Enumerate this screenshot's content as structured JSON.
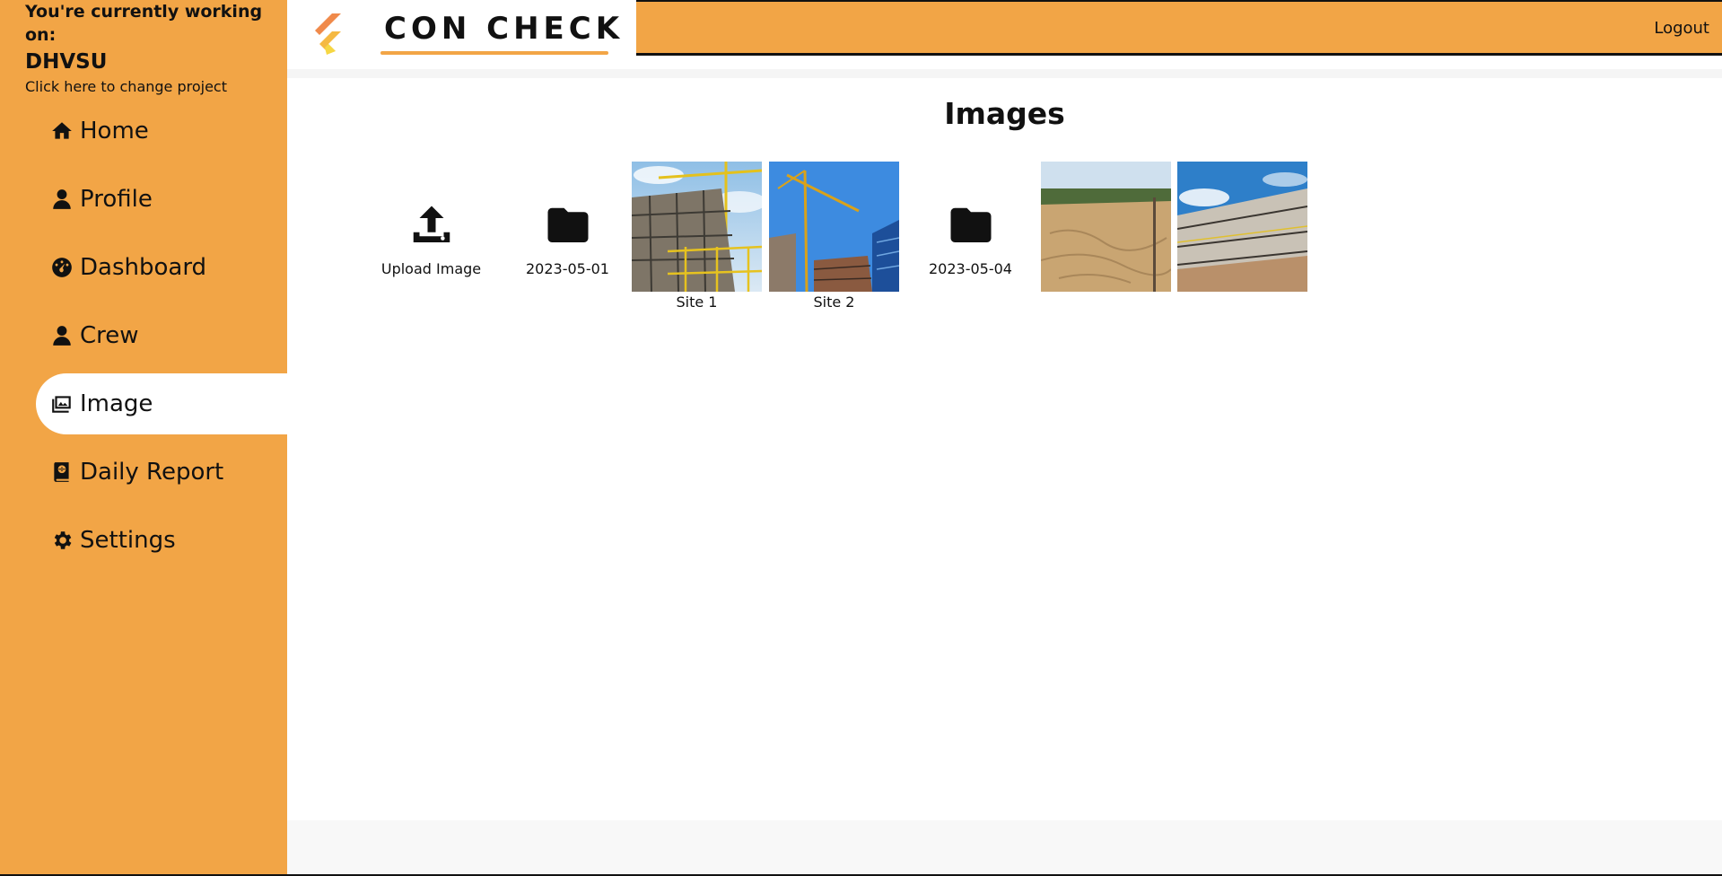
{
  "project": {
    "caption": "You're currently working on:",
    "name": "DHVSU",
    "change_link": "Click here to change project"
  },
  "brand": {
    "logo_text": "CON CHECK",
    "accent_color": "#F2A546"
  },
  "header": {
    "logout_label": "Logout"
  },
  "nav": [
    {
      "label": "Home",
      "icon": "home-icon"
    },
    {
      "label": "Profile",
      "icon": "person-icon"
    },
    {
      "label": "Dashboard",
      "icon": "dashboard-icon"
    },
    {
      "label": "Crew",
      "icon": "person-icon"
    },
    {
      "label": "Image",
      "icon": "photo-library-icon",
      "active": true
    },
    {
      "label": "Daily Report",
      "icon": "report-book-icon"
    },
    {
      "label": "Settings",
      "icon": "gear-icon"
    }
  ],
  "main": {
    "title": "Images",
    "tiles": [
      {
        "kind": "upload",
        "label": "Upload Image",
        "icon": "upload-icon"
      },
      {
        "kind": "folder",
        "label": "2023-05-01",
        "icon": "folder-icon"
      },
      {
        "kind": "photo",
        "label": "Site 1"
      },
      {
        "kind": "photo",
        "label": "Site 2"
      },
      {
        "kind": "folder",
        "label": "2023-05-04",
        "icon": "folder-icon"
      },
      {
        "kind": "photo",
        "label": ""
      },
      {
        "kind": "photo",
        "label": ""
      }
    ]
  }
}
